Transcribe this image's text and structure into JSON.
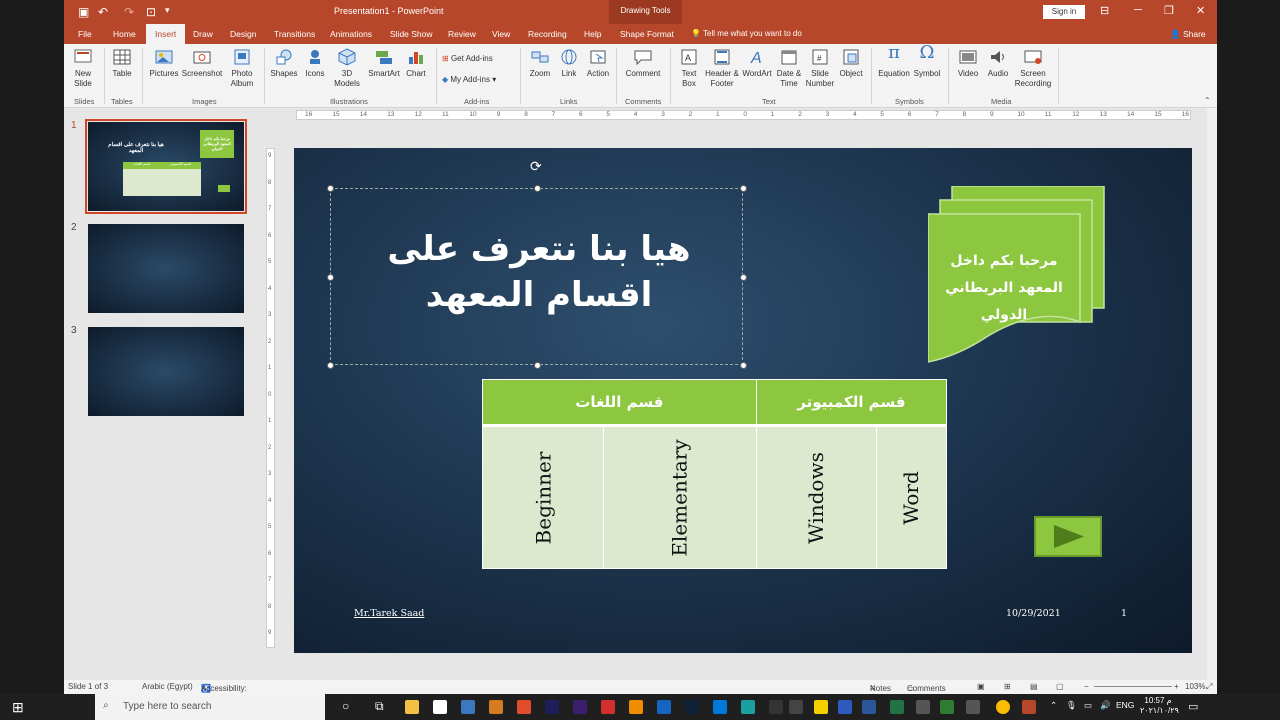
{
  "titlebar": {
    "title": "Presentation1  -  PowerPoint",
    "contextual": "Drawing Tools",
    "signin": "Sign in"
  },
  "tabs": [
    "File",
    "Home",
    "Insert",
    "Draw",
    "Design",
    "Transitions",
    "Animations",
    "Slide Show",
    "Review",
    "View",
    "Recording",
    "Help",
    "Shape Format"
  ],
  "tell_me": "Tell me what you want to do",
  "share": "Share",
  "ribbon": {
    "groups": [
      "Slides",
      "Tables",
      "Images",
      "Illustrations",
      "Add-ins",
      "Links",
      "Comments",
      "Text",
      "Symbols",
      "Media"
    ],
    "buttons": [
      {
        "label": "New Slide",
        "icon": "new-slide-icon"
      },
      {
        "label": "Table",
        "icon": "table-icon"
      },
      {
        "label": "Pictures",
        "icon": "pictures-icon"
      },
      {
        "label": "Screenshot",
        "icon": "screenshot-icon"
      },
      {
        "label": "Photo Album",
        "icon": "photo-album-icon"
      },
      {
        "label": "Shapes",
        "icon": "shapes-icon"
      },
      {
        "label": "Icons",
        "icon": "icons-icon"
      },
      {
        "label": "3D Models",
        "icon": "3d-models-icon"
      },
      {
        "label": "SmartArt",
        "icon": "smartart-icon"
      },
      {
        "label": "Chart",
        "icon": "chart-icon"
      },
      {
        "label": "Get Add-ins",
        "icon": "get-addins-icon"
      },
      {
        "label": "My Add-ins",
        "icon": "my-addins-icon"
      },
      {
        "label": "Zoom",
        "icon": "zoom-icon"
      },
      {
        "label": "Link",
        "icon": "link-icon"
      },
      {
        "label": "Action",
        "icon": "action-icon"
      },
      {
        "label": "Comment",
        "icon": "comment-icon"
      },
      {
        "label": "Text Box",
        "icon": "textbox-icon"
      },
      {
        "label": "Header & Footer",
        "icon": "header-footer-icon"
      },
      {
        "label": "WordArt",
        "icon": "wordart-icon"
      },
      {
        "label": "Date & Time",
        "icon": "date-time-icon"
      },
      {
        "label": "Slide Number",
        "icon": "slide-number-icon"
      },
      {
        "label": "Object",
        "icon": "object-icon"
      },
      {
        "label": "Equation",
        "icon": "equation-icon"
      },
      {
        "label": "Symbol",
        "icon": "symbol-icon"
      },
      {
        "label": "Video",
        "icon": "video-icon"
      },
      {
        "label": "Audio",
        "icon": "audio-icon"
      },
      {
        "label": "Screen Recording",
        "icon": "screen-recording-icon"
      }
    ]
  },
  "thumbnails": {
    "numbers": [
      "1",
      "2",
      "3"
    ],
    "slide1_title": "هيا بنا نتعرف على اقسام المعهد",
    "slide1_scroll": "مرحبا بكم داخل المعهد البريطاني الدولي",
    "slide1_col1": "قسم الكمبيوتر",
    "slide1_col2": "قسم اللغات"
  },
  "ruler": {
    "h": [
      "16",
      "15",
      "14",
      "13",
      "12",
      "11",
      "10",
      "9",
      "8",
      "7",
      "6",
      "5",
      "4",
      "3",
      "2",
      "1",
      "0",
      "1",
      "2",
      "3",
      "4",
      "5",
      "6",
      "7",
      "8",
      "9",
      "10",
      "11",
      "12",
      "13",
      "14",
      "15",
      "16"
    ],
    "v": [
      "9",
      "8",
      "7",
      "6",
      "5",
      "4",
      "3",
      "2",
      "1",
      "0",
      "1",
      "2",
      "3",
      "4",
      "5",
      "6",
      "7",
      "8",
      "9"
    ]
  },
  "slide": {
    "title": "هيا بنا نتعرف على اقسام المعهد",
    "scroll_text": "مرحبا بكم داخل المعهد البريطاني الدولي",
    "table": {
      "headers": [
        "قسم اللغات",
        "قسم الكمبيوتر"
      ],
      "cells": [
        "Beginner",
        "Elementary",
        "Windows",
        "Word"
      ]
    },
    "footer_left": "Mr.Tarek Saad",
    "footer_date": "10/29/2021",
    "footer_num": "1",
    "accent": "#8dc63f"
  },
  "status": {
    "slide": "Slide 1 of 3",
    "language": "Arabic (Egypt)",
    "accessibility": "Accessibility: Investigate",
    "notes": "Notes",
    "comments": "Comments",
    "zoom": "103%"
  },
  "taskbar": {
    "search": "Type here to search",
    "lang": "ENG",
    "time": "10:57 م",
    "date": "٢٠٢١/١٠/٢٩"
  }
}
